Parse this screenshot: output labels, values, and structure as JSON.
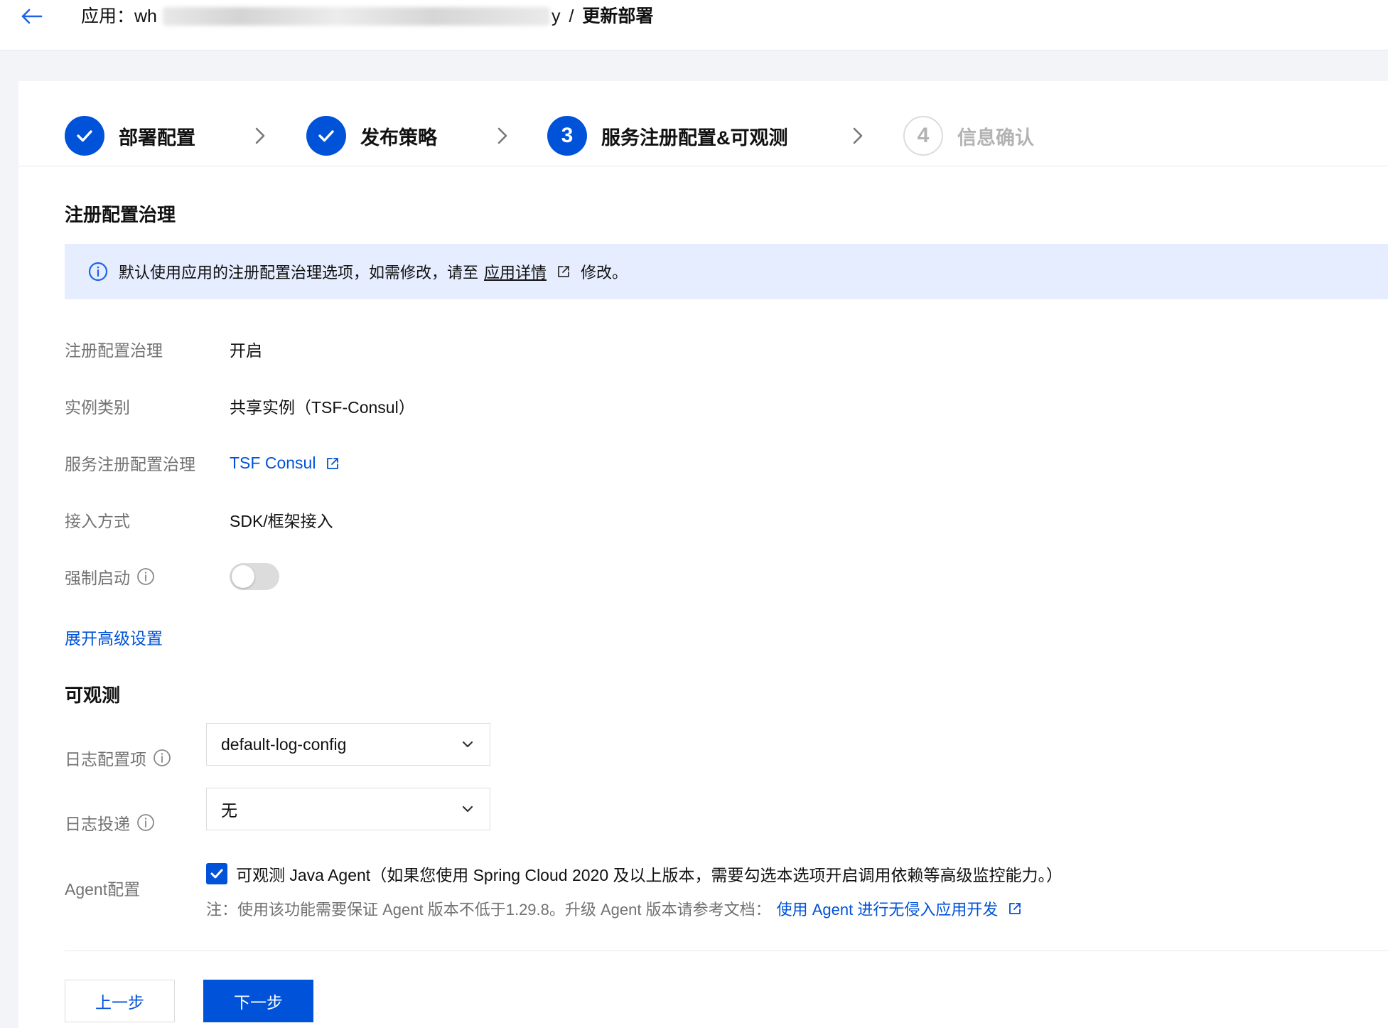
{
  "header": {
    "app_prefix": "应用：wh",
    "app_suffix": "y",
    "separator": "/",
    "page_title": "更新部署"
  },
  "steps": [
    {
      "index": "1",
      "label": "部署配置",
      "status": "done"
    },
    {
      "index": "2",
      "label": "发布策略",
      "status": "done"
    },
    {
      "index": "3",
      "label": "服务注册配置&可观测",
      "status": "active"
    },
    {
      "index": "4",
      "label": "信息确认",
      "status": "pending"
    }
  ],
  "registry": {
    "section_title": "注册配置治理",
    "notice_text": "默认使用应用的注册配置治理选项，如需修改，请至",
    "notice_link": "应用详情",
    "notice_suffix": "修改。",
    "rows": [
      {
        "label": "注册配置治理",
        "value": "开启"
      },
      {
        "label": "实例类别",
        "value": "共享实例（TSF-Consul）"
      },
      {
        "label": "服务注册配置治理",
        "value": "TSF Consul"
      },
      {
        "label": "接入方式",
        "value": "SDK/框架接入"
      },
      {
        "label": "强制启动",
        "value": "off"
      }
    ],
    "advanced_link": "展开高级设置"
  },
  "observability": {
    "section_title": "可观测",
    "log_config_label": "日志配置项",
    "log_config_value": "default-log-config",
    "log_delivery_label": "日志投递",
    "log_delivery_value": "无",
    "agent_label": "Agent配置",
    "agent_checked": true,
    "agent_text": "可观测 Java Agent（如果您使用 Spring Cloud 2020 及以上版本，需要勾选本选项开启调用依赖等高级监控能力。）",
    "agent_note": "注：使用该功能需要保证 Agent 版本不低于1.29.8。升级 Agent 版本请参考文档：",
    "agent_note_link": "使用 Agent 进行无侵入应用开发"
  },
  "footer": {
    "prev_label": "上一步",
    "next_label": "下一步"
  },
  "colors": {
    "primary": "#0052d9",
    "notice_bg": "#e5edff",
    "muted": "#727272"
  }
}
